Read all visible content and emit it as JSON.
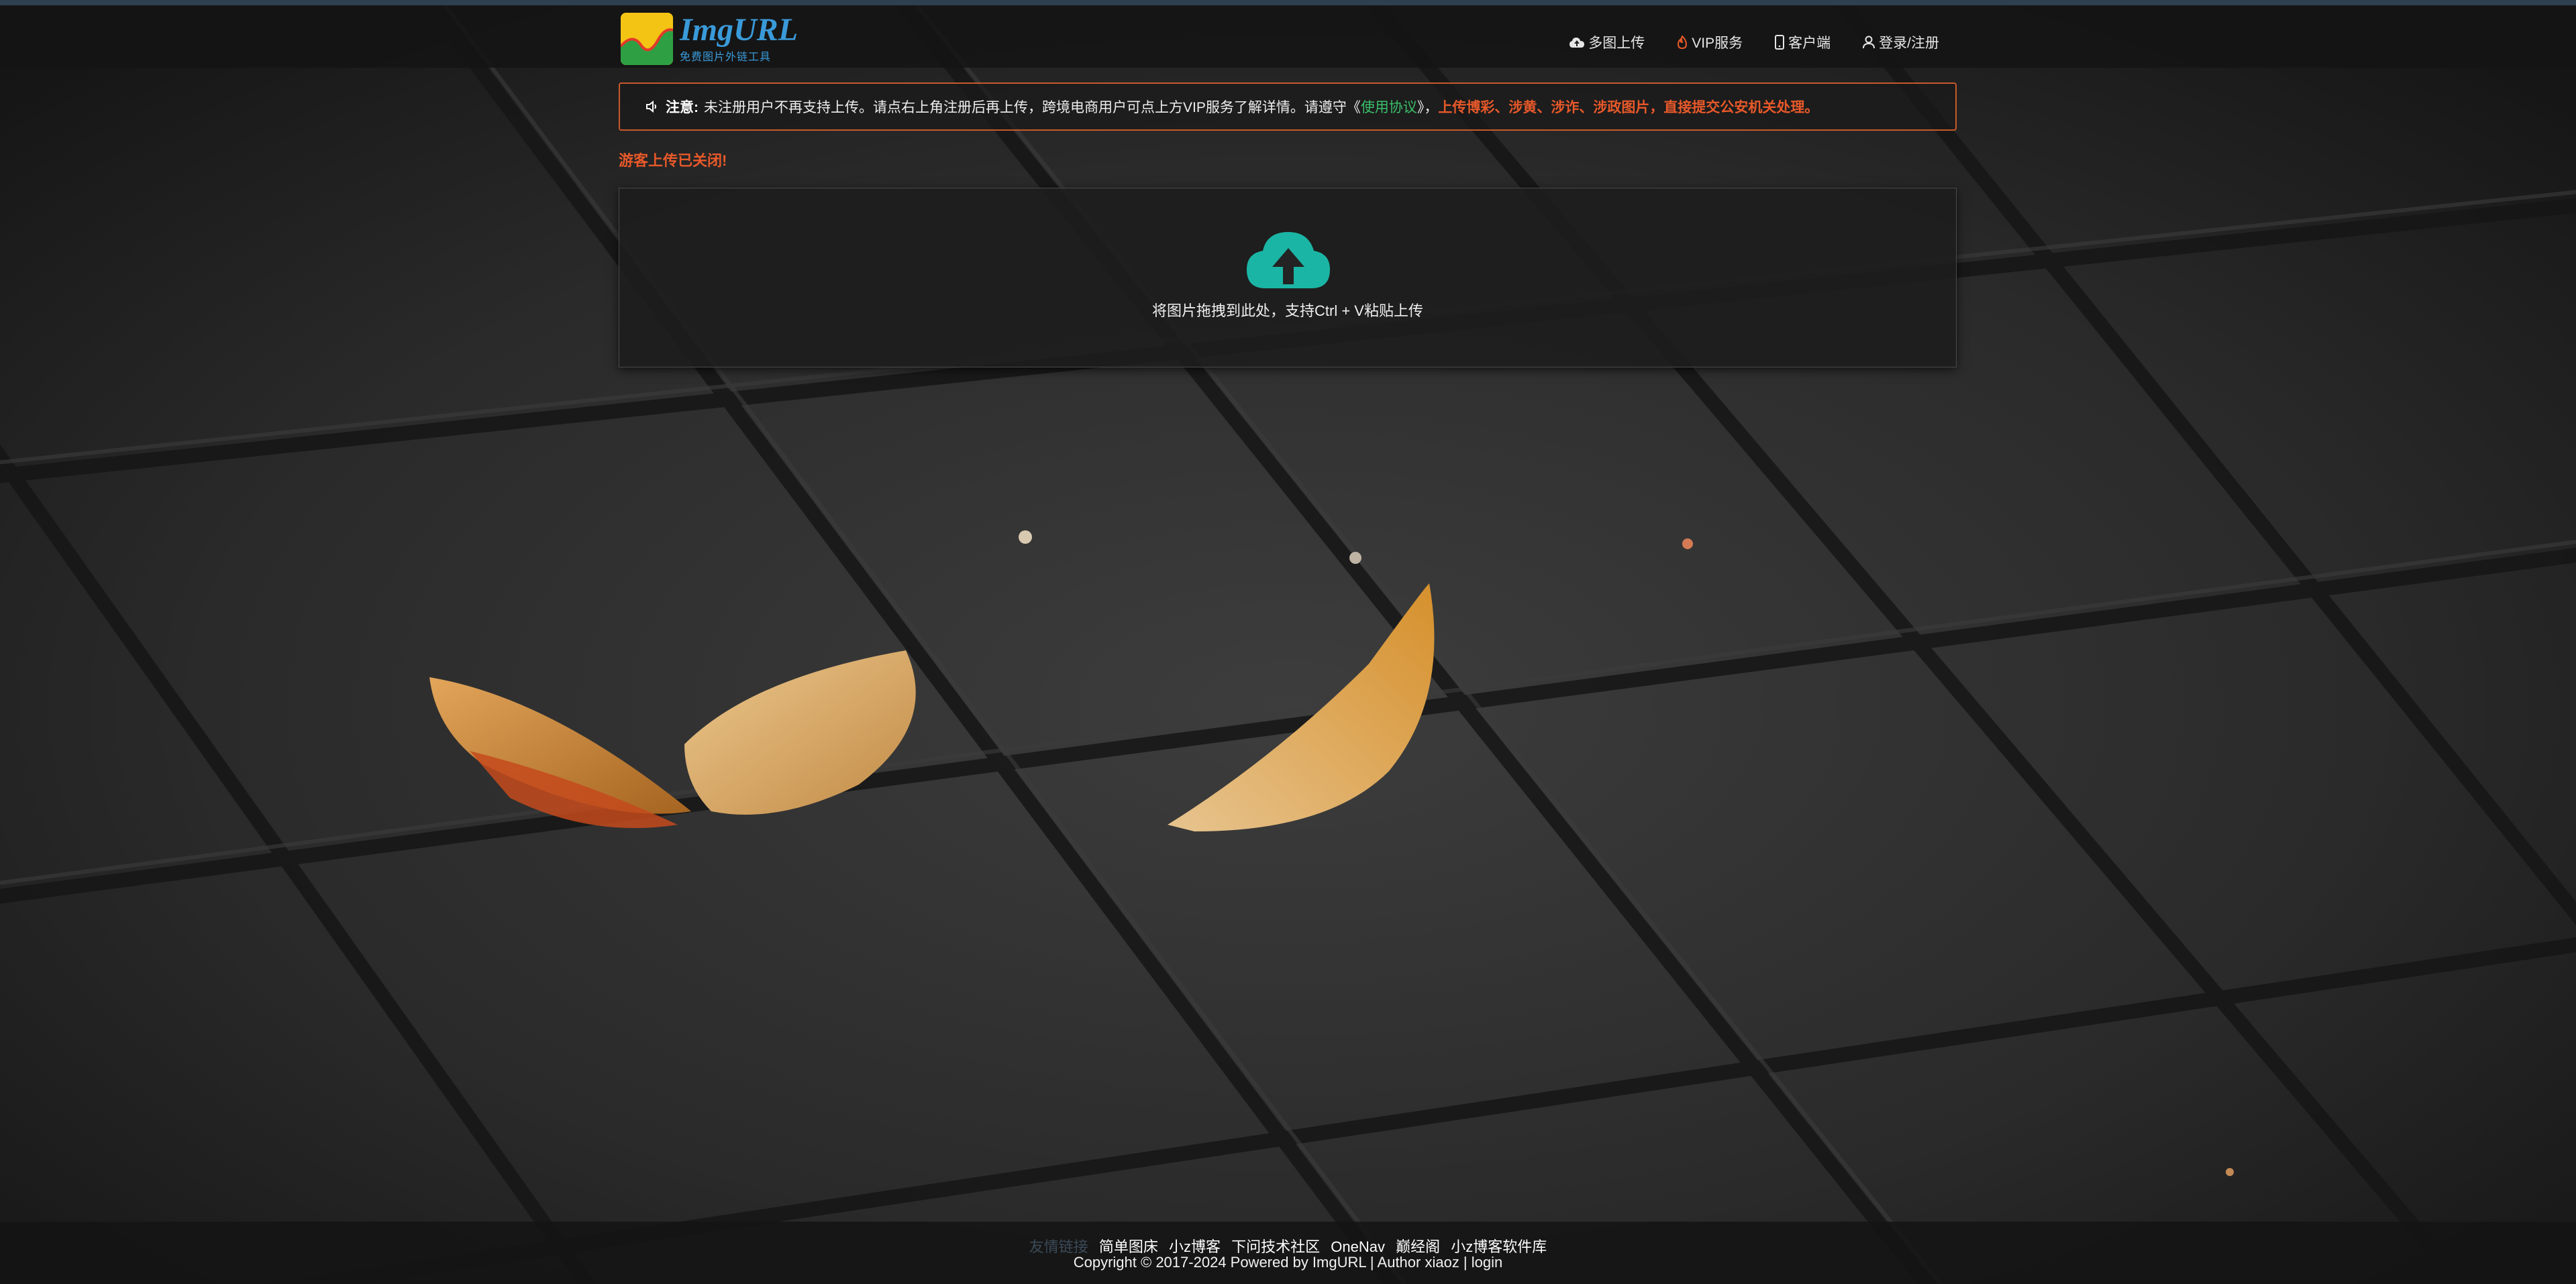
{
  "brand": {
    "name": "ImgURL",
    "tagline": "免费图片外链工具",
    "colors": {
      "blue": "#3a9ad9",
      "yellow": "#f3c413",
      "green": "#2ea043"
    }
  },
  "nav": {
    "items": [
      {
        "label": "多图上传",
        "icon": "cloud-upload-icon"
      },
      {
        "label": "VIP服务",
        "icon": "fire-icon"
      },
      {
        "label": "客户端",
        "icon": "mobile-icon"
      },
      {
        "label": "登录/注册",
        "icon": "user-icon"
      }
    ]
  },
  "notice": {
    "icon": "speaker-icon",
    "label": "注意:",
    "text_before": "未注册用户不再支持上传。请点右上角注册后再上传，跨境电商用户可点上方VIP服务了解详情。请遵守《",
    "agreement_link": "使用协议",
    "text_after": "》，",
    "warning": "上传博彩、涉黄、涉诈、涉政图片，直接提交公安机关处理。",
    "border_color": "#c8592a",
    "warning_color": "#e8592a"
  },
  "status": {
    "guest_closed": "游客上传已关闭!"
  },
  "upload": {
    "icon": "cloud-upload-icon",
    "hint": "将图片拖拽到此处，支持Ctrl + V粘贴上传",
    "icon_color": "#1bb5a5"
  },
  "footer": {
    "friends_label": "友情链接",
    "links": [
      "简单图床",
      "小z博客",
      "下问技术社区",
      "OneNav",
      "巅经阁",
      "小z博客软件库"
    ],
    "copyright": "Copyright © 2017-2024 Powered by ImgURL | Author xiaoz | login"
  }
}
